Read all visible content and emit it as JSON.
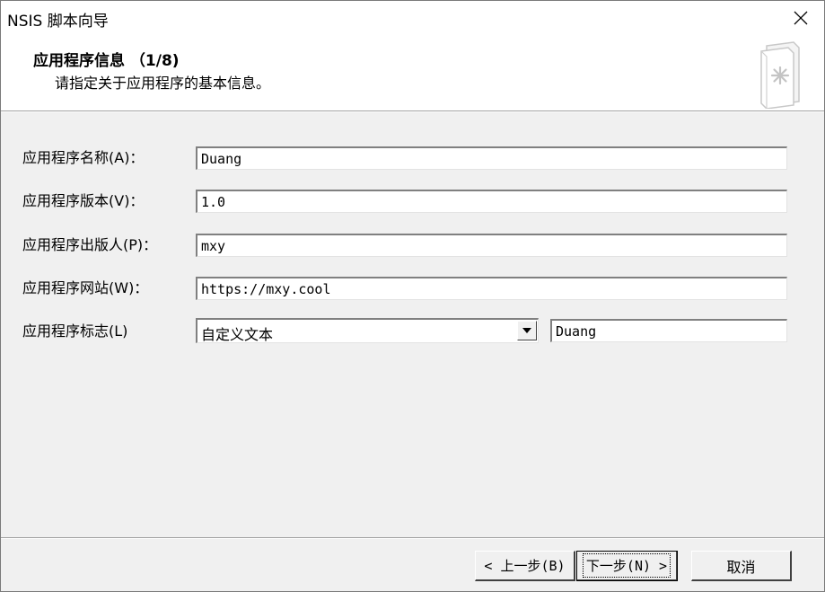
{
  "window": {
    "title": "NSIS 脚本向导"
  },
  "header": {
    "title": "应用程序信息 （1/8)",
    "subtitle": "请指定关于应用程序的基本信息。",
    "icon": "wizard-page-icon"
  },
  "form": {
    "name": {
      "label": "应用程序名称(A)：",
      "value": "Duang"
    },
    "version": {
      "label": "应用程序版本(V)：",
      "value": "1.0"
    },
    "publisher": {
      "label": "应用程序出版人(P)：",
      "value": "mxy"
    },
    "website": {
      "label": "应用程序网站(W)：",
      "value": "https://mxy.cool"
    },
    "brand": {
      "label": "应用程序标志(L)",
      "selected": "自定义文本",
      "text_value": "Duang"
    }
  },
  "buttons": {
    "back": "< 上一步(B)",
    "next": "下一步(N) >",
    "cancel": "取消"
  },
  "colors": {
    "dialog_bg": "#f0f0f0",
    "header_bg": "#ffffff",
    "field_bg": "#ffffff"
  }
}
